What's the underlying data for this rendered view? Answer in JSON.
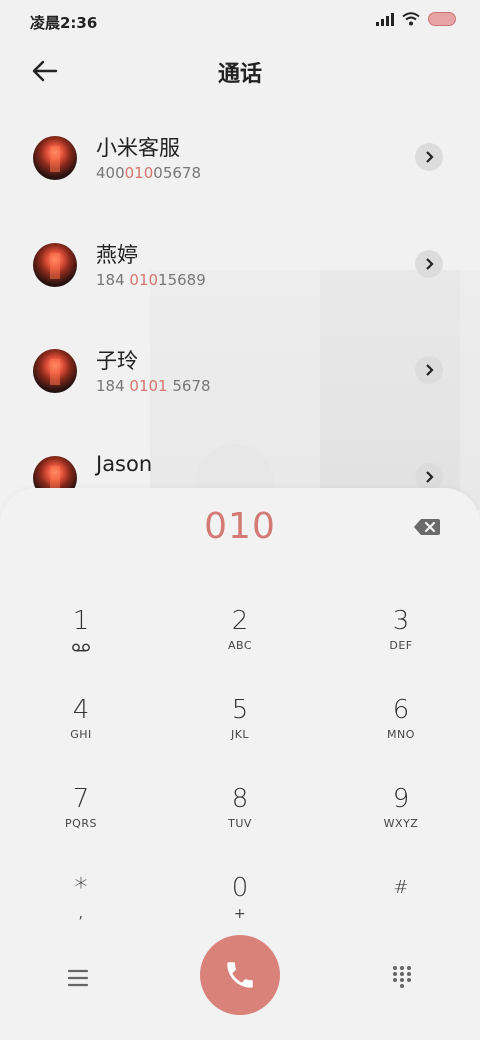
{
  "status_bar": {
    "time": "凌晨2:36"
  },
  "header": {
    "title": "通话"
  },
  "contacts": [
    {
      "name": "小米客服",
      "num_pre": "400",
      "num_hl": "010",
      "num_post": "05678"
    },
    {
      "name": "燕婷",
      "num_pre": "184 ",
      "num_hl": "010",
      "num_post": "15689"
    },
    {
      "name": "子玲",
      "num_pre": "184 ",
      "num_hl": "0101",
      "num_post": " 5678"
    },
    {
      "name": "Jason",
      "num_pre": "",
      "num_hl": "",
      "num_post": ""
    }
  ],
  "dialpad": {
    "display": "010",
    "keys": [
      {
        "digit": "1",
        "letters": ""
      },
      {
        "digit": "2",
        "letters": "ABC"
      },
      {
        "digit": "3",
        "letters": "DEF"
      },
      {
        "digit": "4",
        "letters": "GHI"
      },
      {
        "digit": "5",
        "letters": "JKL"
      },
      {
        "digit": "6",
        "letters": "MNO"
      },
      {
        "digit": "7",
        "letters": "PQRS"
      },
      {
        "digit": "8",
        "letters": "TUV"
      },
      {
        "digit": "9",
        "letters": "WXYZ"
      },
      {
        "digit": "*",
        "letters": ","
      },
      {
        "digit": "0",
        "letters": "+"
      },
      {
        "digit": "#",
        "letters": ""
      }
    ]
  },
  "colors": {
    "accent": "#d9827a",
    "highlight": "#d9756f",
    "background": "#f1f1f1"
  },
  "icons": {
    "back": "arrow-left-icon",
    "backspace": "backspace-icon",
    "menu": "menu-icon",
    "call": "phone-icon",
    "grid": "dialpad-grid-icon",
    "voicemail": "voicemail-icon"
  }
}
